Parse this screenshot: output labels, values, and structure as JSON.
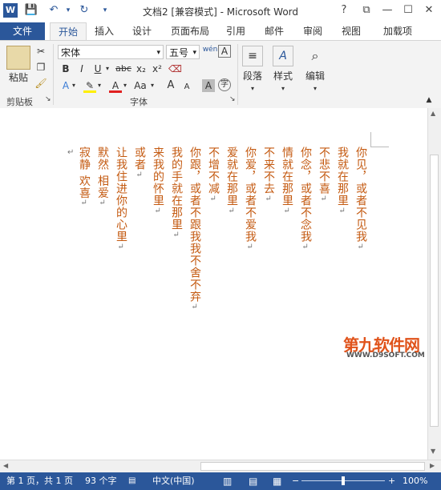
{
  "window": {
    "title": "文档2 [兼容模式] - Microsoft Word",
    "help": "?",
    "min": "—",
    "restore": "☐",
    "close": "✕"
  },
  "tabs": [
    "文件",
    "开始",
    "插入",
    "设计",
    "页面布局",
    "引用",
    "邮件",
    "审阅",
    "视图",
    "加载项"
  ],
  "ribbon": {
    "clipboard": {
      "paste": "粘贴",
      "label": "剪贴板"
    },
    "font": {
      "name": "宋体",
      "size": "五号",
      "wen": "wén",
      "bold": "B",
      "italic": "I",
      "underline": "U",
      "strike": "abc",
      "sub": "x₂",
      "sup": "x²",
      "grow": "A",
      "shrink": "A",
      "case": "Aa",
      "label": "字体"
    },
    "paragraph": {
      "label": "段落"
    },
    "styles": {
      "label": "样式"
    },
    "editing": {
      "label": "编辑"
    }
  },
  "document": {
    "columns": [
      "你见，或者不见我",
      "我就在那里",
      "不悲不喜",
      "你念，或者不念我",
      "情就在那里",
      "不来不去",
      "你爱，或者不爱我",
      "爱就在那里",
      "不增不减",
      "你跟，或者不跟我我不舍不弃",
      "我的手就在那里",
      "来我的怀里",
      "或者",
      "让我住进你的心里",
      "默然  相爱",
      "寂静  欢喜"
    ]
  },
  "watermark": {
    "main": "第九软件网",
    "sub": "WWW.D9SOFT.COM"
  },
  "status": {
    "page": "第 1 页，共 1 页",
    "words": "93 个字",
    "lang": "中文(中国)",
    "zoom": "100%"
  },
  "colors": {
    "accent": "#2b579a",
    "text": "#c45a11"
  }
}
